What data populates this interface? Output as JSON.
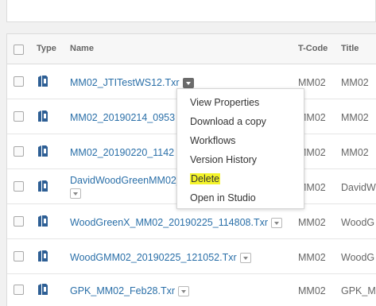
{
  "columns": {
    "type": "Type",
    "name": "Name",
    "tcode": "T-Code",
    "title": "Title"
  },
  "rows": [
    {
      "name": "MM02_JTITestWS12.Txr",
      "tcode": "MM02",
      "title": "MM02"
    },
    {
      "name": "MM02_20190214_0953",
      "tcode": "MM02",
      "title": "MM02"
    },
    {
      "name": "MM02_20190220_1142",
      "tcode": "MM02",
      "title": "MM02"
    },
    {
      "name": "DavidWoodGreenMM02_",
      "tcode": "MM02",
      "title": "DavidW"
    },
    {
      "name": "WoodGreenX_MM02_20190225_114808.Txr",
      "tcode": "MM02",
      "title": "WoodG"
    },
    {
      "name": "WoodGMM02_20190225_121052.Txr",
      "tcode": "MM02",
      "title": "WoodG"
    },
    {
      "name": "GPK_MM02_Feb28.Txr",
      "tcode": "MM02",
      "title": "GPK_M"
    }
  ],
  "context_menu": {
    "items": [
      "View Properties",
      "Download a copy",
      "Workflows",
      "Version History",
      "Delete",
      "Open in Studio"
    ],
    "highlighted": "Delete",
    "highlight_color": "#f4f42a"
  },
  "colors": {
    "link": "#2a6fa8",
    "icon": "#2e5f95"
  }
}
